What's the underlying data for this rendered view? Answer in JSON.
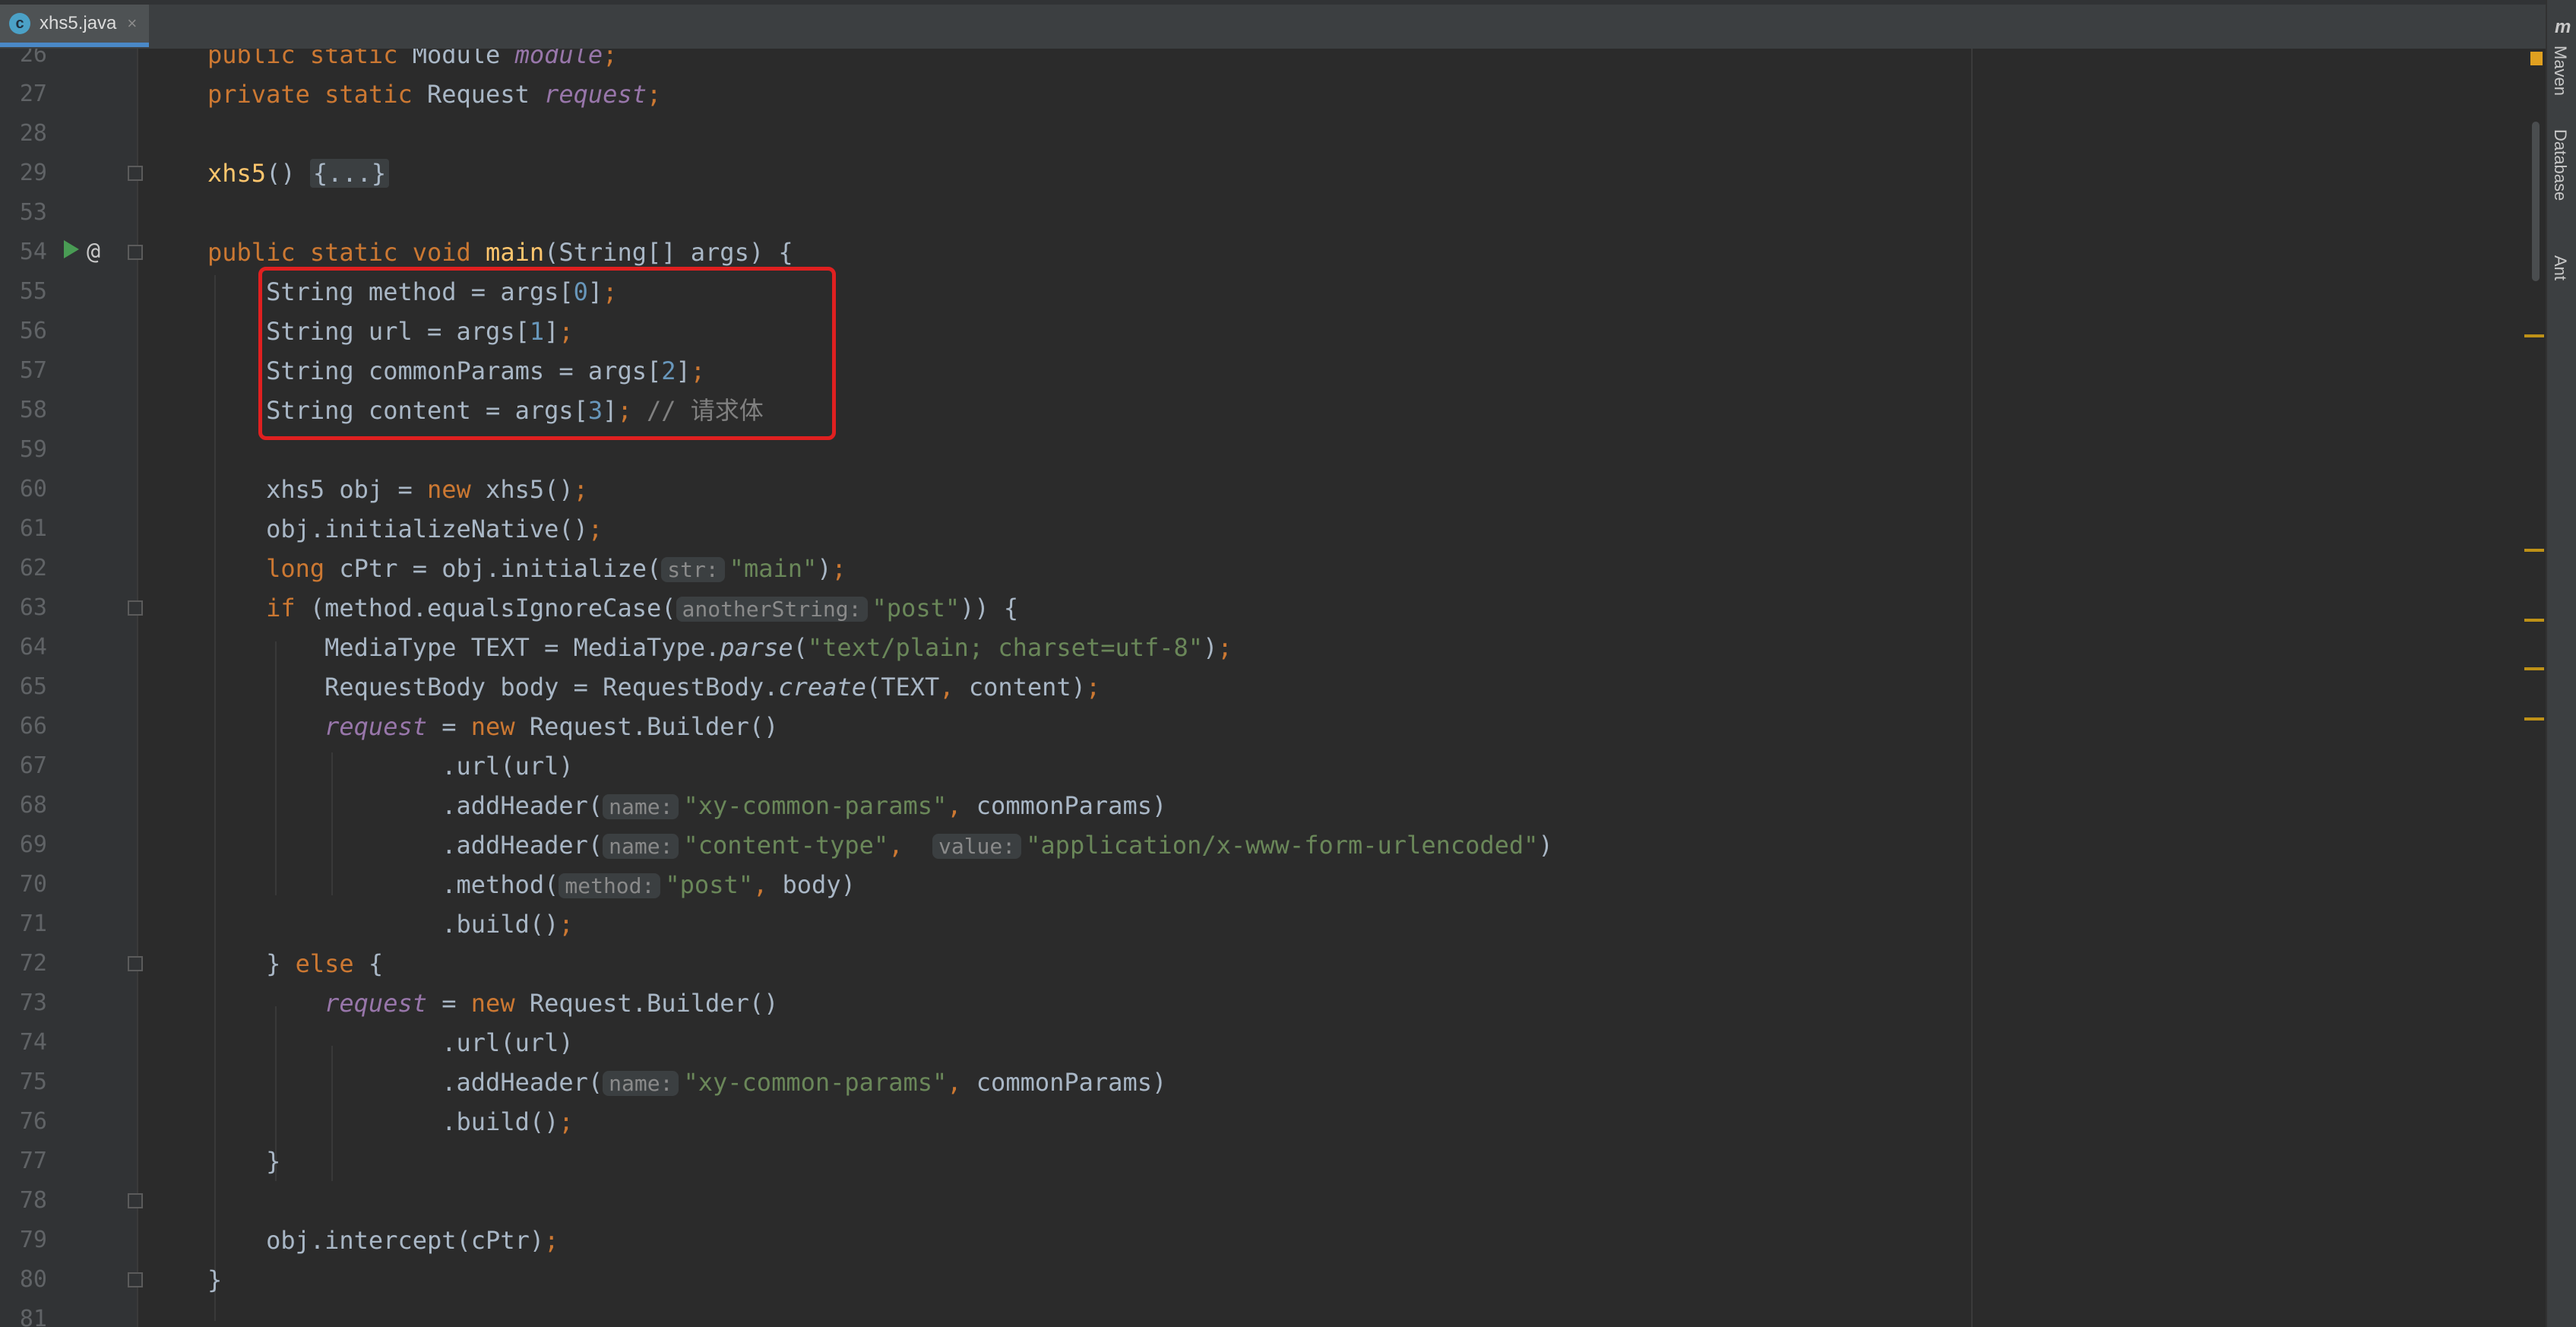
{
  "tab": {
    "filename": "xhs5.java",
    "icon": "c",
    "close": "×"
  },
  "sidebar": {
    "logo": "m",
    "maven": "Maven",
    "database": "Database",
    "ant": "Ant"
  },
  "lines": [
    {
      "n": "26",
      "s": [
        [
          "kw",
          "public static "
        ],
        [
          "",
          "Module "
        ],
        [
          "fld",
          "module"
        ],
        [
          "kw",
          ";"
        ]
      ]
    },
    {
      "n": "27",
      "s": [
        [
          "kw",
          "private static "
        ],
        [
          "",
          "Request "
        ],
        [
          "fld",
          "request"
        ],
        [
          "kw",
          ";"
        ]
      ]
    },
    {
      "n": "28",
      "s": []
    },
    {
      "n": "29",
      "s": [
        [
          "mth",
          "xhs5"
        ],
        [
          "",
          "() "
        ],
        [
          "collapsed",
          "{...}"
        ]
      ]
    },
    {
      "n": "53",
      "s": []
    },
    {
      "n": "54",
      "s": [
        [
          "kw",
          "public static void "
        ],
        [
          "mth",
          "main"
        ],
        [
          "",
          "(String[] args) {"
        ]
      ]
    },
    {
      "n": "55",
      "s": [
        [
          "",
          "    String method = args["
        ],
        [
          "num",
          "0"
        ],
        [
          "",
          "]"
        ],
        [
          "kw",
          ";"
        ]
      ]
    },
    {
      "n": "56",
      "s": [
        [
          "",
          "    String url = args["
        ],
        [
          "num",
          "1"
        ],
        [
          "",
          "]"
        ],
        [
          "kw",
          ";"
        ]
      ]
    },
    {
      "n": "57",
      "s": [
        [
          "",
          "    String commonParams = args["
        ],
        [
          "num",
          "2"
        ],
        [
          "",
          "]"
        ],
        [
          "kw",
          ";"
        ]
      ]
    },
    {
      "n": "58",
      "s": [
        [
          "",
          "    String content = args["
        ],
        [
          "num",
          "3"
        ],
        [
          "",
          "]"
        ],
        [
          "kw",
          "; "
        ],
        [
          "cmt",
          "// 请求体"
        ]
      ]
    },
    {
      "n": "59",
      "s": []
    },
    {
      "n": "60",
      "s": [
        [
          "",
          "    xhs5 obj = "
        ],
        [
          "kw",
          "new "
        ],
        [
          "",
          "xhs5()"
        ],
        [
          "kw",
          ";"
        ]
      ]
    },
    {
      "n": "61",
      "s": [
        [
          "",
          "    obj.initializeNative()"
        ],
        [
          "kw",
          ";"
        ]
      ]
    },
    {
      "n": "62",
      "s": [
        [
          "kw",
          "    long "
        ],
        [
          "",
          "cPtr = obj.initialize("
        ],
        [
          "hint",
          "str:"
        ],
        [
          "str",
          "\"main\""
        ],
        [
          "",
          ")"
        ],
        [
          "kw",
          ";"
        ]
      ]
    },
    {
      "n": "63",
      "s": [
        [
          "kw",
          "    if "
        ],
        [
          "",
          "(method.equalsIgnoreCase("
        ],
        [
          "hint",
          "anotherString:"
        ],
        [
          "str",
          "\"post\""
        ],
        [
          "",
          ")) {"
        ]
      ]
    },
    {
      "n": "64",
      "s": [
        [
          "",
          "        MediaType TEXT = MediaType."
        ],
        [
          "it",
          "parse"
        ],
        [
          "",
          "("
        ],
        [
          "str",
          "\"text/plain; charset=utf-8\""
        ],
        [
          "",
          ")"
        ],
        [
          "kw",
          ";"
        ]
      ]
    },
    {
      "n": "65",
      "s": [
        [
          "",
          "        RequestBody body = RequestBody."
        ],
        [
          "it",
          "create"
        ],
        [
          "",
          "(TEXT"
        ],
        [
          "kw",
          ", "
        ],
        [
          "",
          "content)"
        ],
        [
          "kw",
          ";"
        ]
      ]
    },
    {
      "n": "66",
      "s": [
        [
          "",
          "        "
        ],
        [
          "fld",
          "request"
        ],
        [
          "",
          " = "
        ],
        [
          "kw",
          "new "
        ],
        [
          "",
          "Request.Builder()"
        ]
      ]
    },
    {
      "n": "67",
      "s": [
        [
          "",
          "                .url(url)"
        ]
      ]
    },
    {
      "n": "68",
      "s": [
        [
          "",
          "                .addHeader("
        ],
        [
          "hint",
          "name:"
        ],
        [
          "str",
          "\"xy-common-params\""
        ],
        [
          "kw",
          ", "
        ],
        [
          "",
          "commonParams)"
        ]
      ]
    },
    {
      "n": "69",
      "s": [
        [
          "",
          "                .addHeader("
        ],
        [
          "hint",
          "name:"
        ],
        [
          "str",
          "\"content-type\""
        ],
        [
          "kw",
          ",  "
        ],
        [
          "hint",
          "value:"
        ],
        [
          "str",
          "\"application/x-www-form-urlencoded\""
        ],
        [
          "",
          ")"
        ]
      ]
    },
    {
      "n": "70",
      "s": [
        [
          "",
          "                .method("
        ],
        [
          "hint",
          "method:"
        ],
        [
          "str",
          "\"post\""
        ],
        [
          "kw",
          ", "
        ],
        [
          "",
          "body)"
        ]
      ]
    },
    {
      "n": "71",
      "s": [
        [
          "",
          "                .build()"
        ],
        [
          "kw",
          ";"
        ]
      ]
    },
    {
      "n": "72",
      "s": [
        [
          "",
          "    } "
        ],
        [
          "kw",
          "else "
        ],
        [
          "",
          "{"
        ]
      ]
    },
    {
      "n": "73",
      "s": [
        [
          "",
          "        "
        ],
        [
          "fld",
          "request"
        ],
        [
          "",
          " = "
        ],
        [
          "kw",
          "new "
        ],
        [
          "",
          "Request.Builder()"
        ]
      ]
    },
    {
      "n": "74",
      "s": [
        [
          "",
          "                .url(url)"
        ]
      ]
    },
    {
      "n": "75",
      "s": [
        [
          "",
          "                .addHeader("
        ],
        [
          "hint",
          "name:"
        ],
        [
          "str",
          "\"xy-common-params\""
        ],
        [
          "kw",
          ", "
        ],
        [
          "",
          "commonParams)"
        ]
      ]
    },
    {
      "n": "76",
      "s": [
        [
          "",
          "                .build()"
        ],
        [
          "kw",
          ";"
        ]
      ]
    },
    {
      "n": "77",
      "s": [
        [
          "",
          "    }"
        ]
      ]
    },
    {
      "n": "78",
      "s": []
    },
    {
      "n": "79",
      "s": [
        [
          "",
          "    obj.intercept(cPtr)"
        ],
        [
          "kw",
          ";"
        ]
      ]
    },
    {
      "n": "80",
      "s": [
        [
          "",
          "}"
        ]
      ]
    },
    {
      "n": "81",
      "s": []
    }
  ]
}
